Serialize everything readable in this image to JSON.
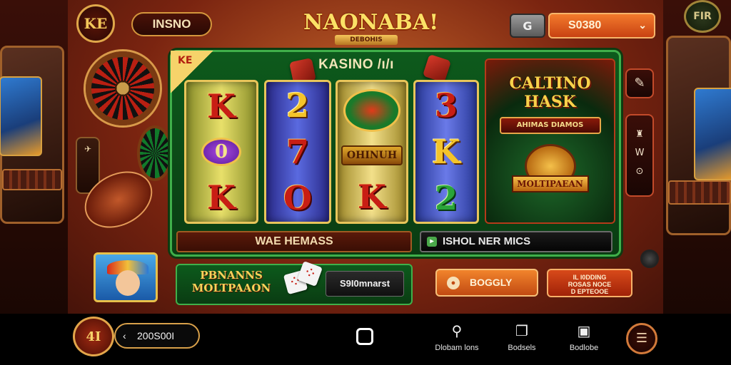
{
  "header": {
    "left_icon_text": "KE",
    "left_pill_label": "INSNO",
    "logo_top": "",
    "logo_title": "NAONABA!",
    "logo_sub": "DEBOHIS",
    "square_button_icon": "G",
    "balance_value": "S0380",
    "balance_chevron": "⌄",
    "right_icon_text": "FIR"
  },
  "board": {
    "corner_badge": "KE",
    "title": "KASINO  /ı/ı",
    "reels": [
      {
        "symbols": [
          "K",
          "0",
          "K"
        ],
        "colors": [
          "red",
          "oval",
          "red"
        ]
      },
      {
        "symbols": [
          "2",
          "7",
          "O"
        ],
        "colors": [
          "yellow",
          "red",
          "red"
        ]
      },
      {
        "symbols": [
          "",
          "OHINUH",
          "K"
        ],
        "colors": [
          "emblem",
          "banner",
          "red"
        ]
      },
      {
        "symbols": [
          "3",
          "K",
          "2"
        ],
        "colors": [
          "red",
          "yellow",
          "green"
        ]
      }
    ],
    "promo": {
      "title_line1": "CALTINO",
      "title_line2": "HASK",
      "subtitle": "AHIMAS DIAMOS",
      "badge": "MOLTIPAEAN"
    },
    "side_buttons": {
      "top_icon": "✎",
      "middle_line1": "♜",
      "middle_line2": "W",
      "middle_line3": "⊙"
    },
    "bar_left": "WAE HEMASS",
    "bar_right": "ISHOL NER MICS",
    "bar_right_icon": "▸"
  },
  "left_decor": {
    "phone_icon": "✈"
  },
  "lower": {
    "bonus_line1": "PBNANNS",
    "bonus_line2": "MOLTPAAON",
    "bonus_amount": "S9I0mnarst",
    "orange_button_label": "BOGGLY",
    "orange_button_icon": "●",
    "red_button_line1": "IL I0DDING",
    "red_button_line2": "ROSAS NOCE",
    "red_button_line3": "D EPTEOOE"
  },
  "bottom": {
    "logo_text": "4I",
    "balance": "200S00I",
    "balance_arrow": "‹",
    "nav": [
      {
        "label": "Dlobam lons",
        "icon": "⚲"
      },
      {
        "label": "Bodsels",
        "icon": "❐"
      },
      {
        "label": "Bodlobe",
        "icon": "▣"
      }
    ],
    "right_button_icon": "☰"
  },
  "colors": {
    "accent_orange": "#c84212",
    "board_green": "#0d5a1c",
    "gold": "#e8c55a"
  }
}
